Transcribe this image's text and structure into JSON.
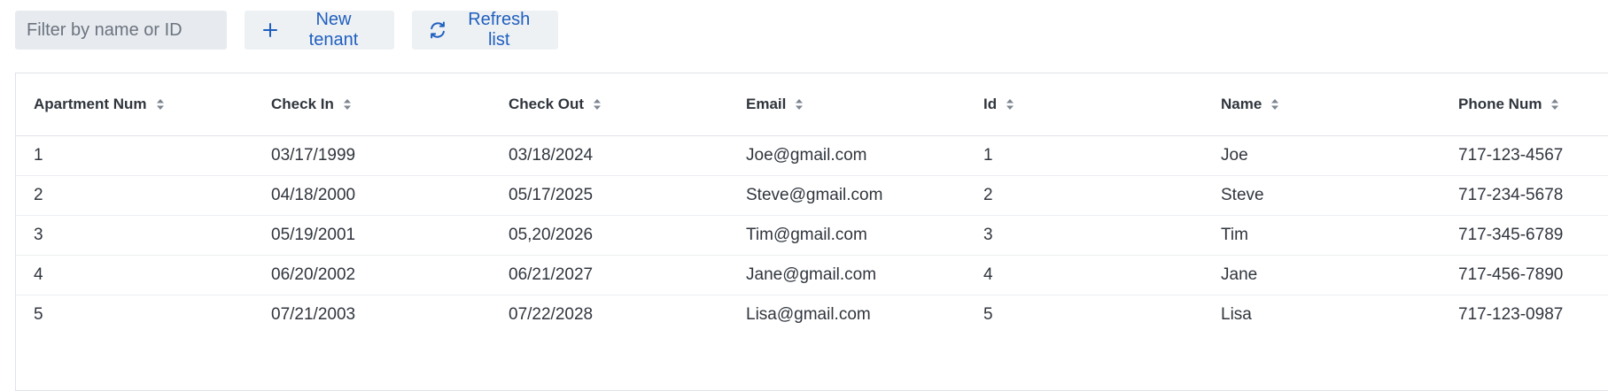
{
  "toolbar": {
    "filter_placeholder": "Filter by name or ID",
    "filter_value": "",
    "new_tenant_label": "New tenant",
    "refresh_label": "Refresh list",
    "new_tenant_icon": "plus-icon",
    "refresh_icon": "refresh-icon"
  },
  "colors": {
    "accent": "#1f5fbf",
    "input_bg": "#e7ebf0",
    "button_bg": "#eef1f4",
    "border": "#dfe3e8"
  },
  "table": {
    "sort_icon": "sort-icon",
    "columns": [
      "Apartment Num",
      "Check In",
      "Check Out",
      "Email",
      "Id",
      "Name",
      "Phone Num"
    ],
    "rows": [
      [
        "1",
        "03/17/1999",
        "03/18/2024",
        "Joe@gmail.com",
        "1",
        "Joe",
        "717-123-4567"
      ],
      [
        "2",
        "04/18/2000",
        "05/17/2025",
        "Steve@gmail.com",
        "2",
        "Steve",
        "717-234-5678"
      ],
      [
        "3",
        "05/19/2001",
        "05,20/2026",
        "Tim@gmail.com",
        "3",
        "Tim",
        "717-345-6789"
      ],
      [
        "4",
        "06/20/2002",
        "06/21/2027",
        "Jane@gmail.com",
        "4",
        "Jane",
        "717-456-7890"
      ],
      [
        "5",
        "07/21/2003",
        "07/22/2028",
        "Lisa@gmail.com",
        "5",
        "Lisa",
        "717-123-0987"
      ]
    ]
  }
}
